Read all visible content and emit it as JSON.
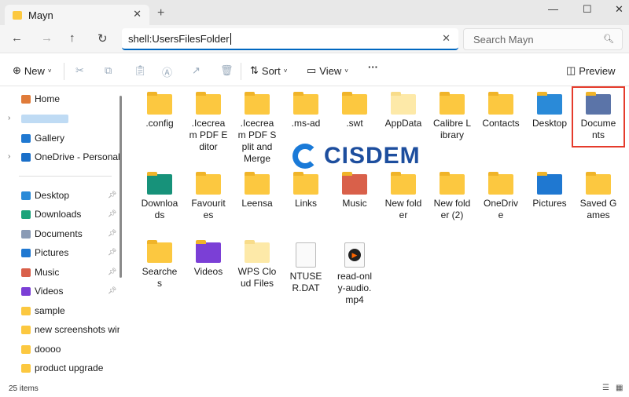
{
  "window": {
    "tab_title": "Mayn",
    "new_tab": "+",
    "controls": [
      "—",
      "☐",
      "✕"
    ]
  },
  "nav": {
    "address": "shell:UsersFilesFolder",
    "search_placeholder": "Search Mayn"
  },
  "toolbar": {
    "new": "New",
    "sort": "Sort",
    "view": "View",
    "more": "···",
    "preview": "Preview"
  },
  "sidebar": {
    "top": [
      {
        "label": "Home",
        "color": "#e07b39"
      },
      {
        "label": "",
        "color": "#7fb7ea"
      },
      {
        "label": "Gallery",
        "color": "#1f78d1"
      },
      {
        "label": "OneDrive - Personal",
        "color": "#1a6fc9"
      }
    ],
    "pinned": [
      {
        "label": "Desktop",
        "color": "#2a8ad8",
        "pinned": true
      },
      {
        "label": "Downloads",
        "color": "#1aa37a",
        "pinned": true
      },
      {
        "label": "Documents",
        "color": "#8a9bb5",
        "pinned": true
      },
      {
        "label": "Pictures",
        "color": "#1f78d1",
        "pinned": true
      },
      {
        "label": "Music",
        "color": "#d9604a",
        "pinned": true
      },
      {
        "label": "Videos",
        "color": "#7b3fd6",
        "pinned": true
      },
      {
        "label": "sample",
        "color": "#fcc840"
      },
      {
        "label": "new screenshots windows",
        "color": "#fcc840"
      },
      {
        "label": "doooo",
        "color": "#fcc840"
      },
      {
        "label": "product upgrade",
        "color": "#fcc840"
      }
    ]
  },
  "status": {
    "count": "25 items"
  },
  "items": [
    {
      "label": ".config",
      "type": "folder"
    },
    {
      "label": ".Icecream PDF Editor",
      "type": "folder"
    },
    {
      "label": ".Icecream PDF Split and Merge",
      "type": "folder"
    },
    {
      "label": ".ms-ad",
      "type": "folder"
    },
    {
      "label": ".swt",
      "type": "folder"
    },
    {
      "label": "AppData",
      "type": "folder-light"
    },
    {
      "label": "Calibre Library",
      "type": "folder"
    },
    {
      "label": "Contacts",
      "type": "folder"
    },
    {
      "label": "Desktop",
      "type": "folder-blue"
    },
    {
      "label": "Documents",
      "type": "folder-doc",
      "selected": true
    },
    {
      "label": "Downloads",
      "type": "folder-green"
    },
    {
      "label": "Favourites",
      "type": "folder"
    },
    {
      "label": "Leensa",
      "type": "folder"
    },
    {
      "label": "Links",
      "type": "folder"
    },
    {
      "label": "Music",
      "type": "folder-music"
    },
    {
      "label": "New folder",
      "type": "folder"
    },
    {
      "label": "New folder (2)",
      "type": "folder"
    },
    {
      "label": "OneDrive",
      "type": "folder"
    },
    {
      "label": "Pictures",
      "type": "folder-pictures"
    },
    {
      "label": "Saved Games",
      "type": "folder"
    },
    {
      "label": "Searches",
      "type": "folder"
    },
    {
      "label": "Videos",
      "type": "folder-video"
    },
    {
      "label": "WPS Cloud Files",
      "type": "folder-light"
    },
    {
      "label": "NTUSER.DAT",
      "type": "file"
    },
    {
      "label": "read-only-audio.mp4",
      "type": "media"
    }
  ],
  "watermark": "CISDEM",
  "colors": {
    "accent": "#0067c0",
    "selection": "#e53b2c"
  }
}
